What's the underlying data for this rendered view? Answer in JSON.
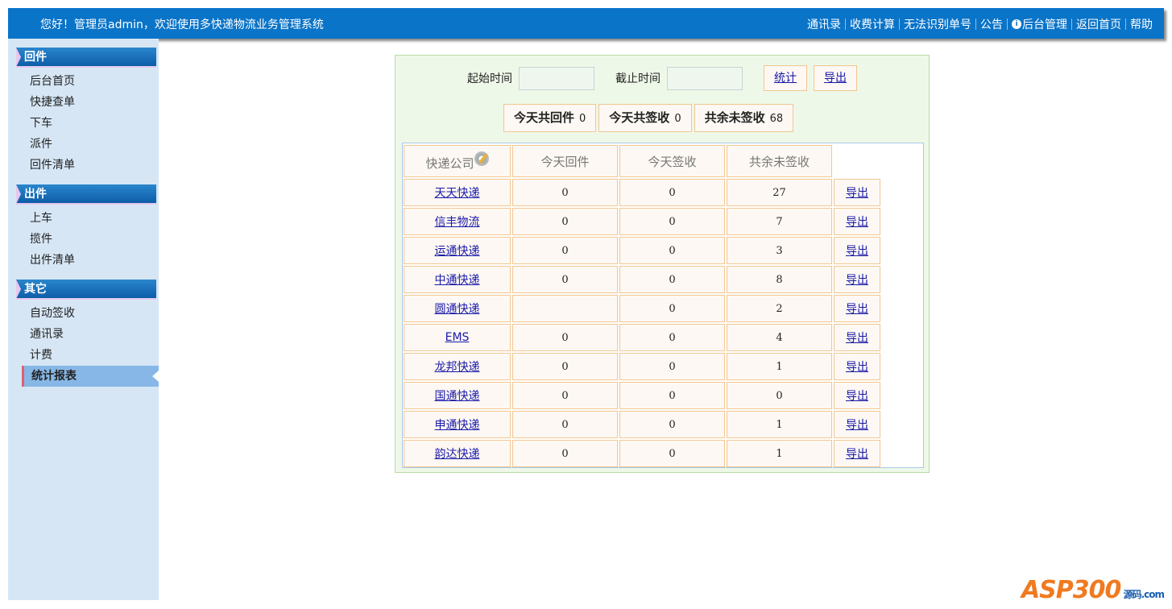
{
  "header": {
    "welcome": "您好！管理员admin，欢迎使用多快递物流业务管理系统",
    "nav": [
      "通讯录",
      "收费计算",
      "无法识别单号",
      "公告",
      "后台管理",
      "返回首页",
      "帮助"
    ]
  },
  "sidebar": {
    "sections": [
      {
        "title": "回件",
        "items": [
          "后台首页",
          "快捷查单",
          "下车",
          "派件",
          "回件清单"
        ]
      },
      {
        "title": "出件",
        "items": [
          "上车",
          "揽件",
          "出件清单"
        ]
      },
      {
        "title": "其它",
        "items": [
          "自动签收",
          "通讯录",
          "计费",
          "统计报表"
        ]
      }
    ],
    "active": "统计报表"
  },
  "filter": {
    "start_label": "起始时间",
    "start_value": "",
    "end_label": "截止时间",
    "end_value": "",
    "stat_button": "统计",
    "export_button": "导出"
  },
  "summary": [
    {
      "label": "今天共回件",
      "value": "0"
    },
    {
      "label": "今天共签收",
      "value": "0"
    },
    {
      "label": "共余未签收",
      "value": "68"
    }
  ],
  "table": {
    "headers": [
      "快递公司",
      "今天回件",
      "今天签收",
      "共余未签收"
    ],
    "export_label": "导出",
    "rows": [
      [
        "天天快递",
        "0",
        "0",
        "27"
      ],
      [
        "信丰物流",
        "0",
        "0",
        "7"
      ],
      [
        "运通快递",
        "0",
        "0",
        "3"
      ],
      [
        "中通快递",
        "0",
        "0",
        "8"
      ],
      [
        "圆通快递",
        "",
        "0",
        "2"
      ],
      [
        "EMS",
        "0",
        "0",
        "4"
      ],
      [
        "龙邦快递",
        "0",
        "0",
        "1"
      ],
      [
        "国通快递",
        "0",
        "0",
        "0"
      ],
      [
        "申通快递",
        "0",
        "0",
        "1"
      ],
      [
        "韵达快递",
        "0",
        "0",
        "1"
      ]
    ]
  },
  "watermark": {
    "text": "ASP300",
    "sub": "源码 .com"
  }
}
